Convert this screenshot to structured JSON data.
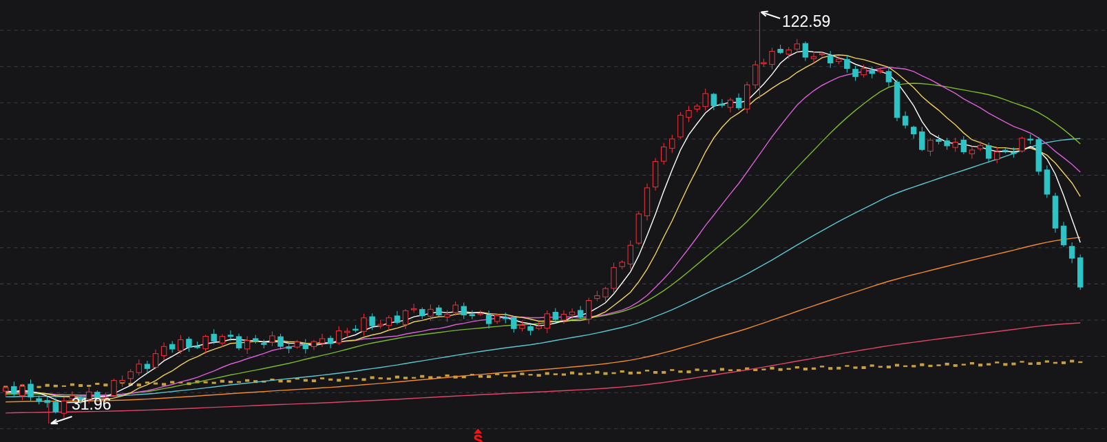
{
  "chart": {
    "annotations": [
      {
        "kind": "high",
        "label": "122.59"
      },
      {
        "kind": "low",
        "label": "31.96"
      }
    ]
  }
}
